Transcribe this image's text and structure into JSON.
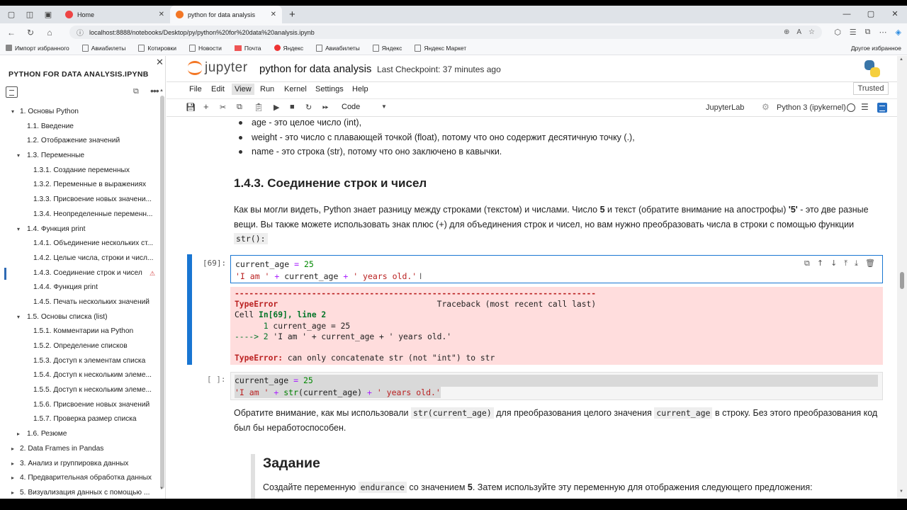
{
  "browser": {
    "tabs": [
      {
        "label": "Home"
      },
      {
        "label": "python for data analysis"
      }
    ],
    "url": "localhost:8888/notebooks/Desktop/py/python%20for%20data%20analysis.ipynb",
    "bookmarks": [
      "Импорт избранного",
      "Авиабилеты",
      "Котировки",
      "Новости",
      "Почта",
      "Яндекс",
      "Авиабилеты",
      "Яндекс",
      "Яндекс Маркет"
    ],
    "bookmarks_right": "Другое избранное"
  },
  "sidebar": {
    "title": "PYTHON FOR DATA ANALYSIS.IPYNB",
    "items": [
      {
        "label": "1. Основы Python",
        "level": 1,
        "caret": "▾"
      },
      {
        "label": "1.1. Введение",
        "level": 2,
        "caret": ""
      },
      {
        "label": "1.2. Отображение значений",
        "level": 2,
        "caret": ""
      },
      {
        "label": "1.3. Переменные",
        "level": 2,
        "caret": "▾"
      },
      {
        "label": "1.3.1. Создание переменных",
        "level": 3,
        "caret": ""
      },
      {
        "label": "1.3.2. Переменные в выражениях",
        "level": 3,
        "caret": ""
      },
      {
        "label": "1.3.3. Присвоение новых значени...",
        "level": 3,
        "caret": ""
      },
      {
        "label": "1.3.4. Неопределенные переменн...",
        "level": 3,
        "caret": ""
      },
      {
        "label": "1.4. Функция print",
        "level": 2,
        "caret": "▾"
      },
      {
        "label": "1.4.1. Объединение нескольких ст...",
        "level": 3,
        "caret": ""
      },
      {
        "label": "1.4.2. Целые числа, строки и числ...",
        "level": 3,
        "caret": ""
      },
      {
        "label": "1.4.3. Соединение строк и чисел",
        "level": 3,
        "caret": "",
        "current": true,
        "warning": "⚠"
      },
      {
        "label": "1.4.4. Функция print",
        "level": 3,
        "caret": ""
      },
      {
        "label": "1.4.5. Печать нескольких значений",
        "level": 3,
        "caret": ""
      },
      {
        "label": "1.5. Основы списка (list)",
        "level": 2,
        "caret": "▾"
      },
      {
        "label": "1.5.1. Комментарии на Python",
        "level": 3,
        "caret": ""
      },
      {
        "label": "1.5.2. Определение списков",
        "level": 3,
        "caret": ""
      },
      {
        "label": "1.5.3. Доступ к элементам списка",
        "level": 3,
        "caret": ""
      },
      {
        "label": "1.5.4. Доступ к нескольким элеме...",
        "level": 3,
        "caret": ""
      },
      {
        "label": "1.5.5. Доступ к нескольким элеме...",
        "level": 3,
        "caret": ""
      },
      {
        "label": "1.5.6. Присвоение новых значений",
        "level": 3,
        "caret": ""
      },
      {
        "label": "1.5.7. Проверка размер списка",
        "level": 3,
        "caret": ""
      },
      {
        "label": "1.6. Резюме",
        "level": 2,
        "caret": "▸"
      },
      {
        "label": "2. Data Frames in Pandas",
        "level": 1,
        "caret": "▸"
      },
      {
        "label": "3. Анализ и группировка данных",
        "level": 1,
        "caret": "▸"
      },
      {
        "label": "4. Предварительная обработка данных",
        "level": 1,
        "caret": "▸"
      },
      {
        "label": "5. Визуализация данных с помощью ...",
        "level": 1,
        "caret": "▸"
      }
    ]
  },
  "header": {
    "logo_text": "jupyter",
    "notebook_name": "python for data analysis",
    "checkpoint": "Last Checkpoint: 37 minutes ago"
  },
  "menu": {
    "items": [
      "File",
      "Edit",
      "View",
      "Run",
      "Kernel",
      "Settings",
      "Help"
    ],
    "trusted": "Trusted"
  },
  "toolbar": {
    "cell_type": "Code",
    "jupyterlab": "JupyterLab",
    "kernel": "Python 3 (ipykernel)"
  },
  "content": {
    "bullets": [
      "age - это целое число (int),",
      "weight - это число с плавающей точкой (float), потому что оно содержит десятичную точку (.),",
      "name - это строка (str), потому что оно заключено в кавычки."
    ],
    "heading": "1.4.3. Соединение строк и чисел",
    "para1_a": "Как вы могли видеть, Python знает разницу между строками (текстом) и числами. Число ",
    "para1_b": "5",
    "para1_c": " и текст (обратите внимание на апострофы) ",
    "para1_d": "'5'",
    "para1_e": " - это две разные вещи. Вы также можете использовать знак плюс (+) для объединения строк и чисел, но вам нужно преобразовать числа в строки с помощью функции",
    "para1_code": "str():",
    "cell1": {
      "prompt": "[69]:",
      "line1_var": "current_age",
      "line1_op": " = ",
      "line1_num": "25",
      "line2_s1": "'I am '",
      "line2_p1": " + ",
      "line2_var": "current_age",
      "line2_p2": " + ",
      "line2_s2": "' years old.'"
    },
    "error": {
      "dashes": "---------------------------------------------------------------------------",
      "type": "TypeError",
      "traceback": "Traceback (most recent call last)",
      "cell_line_a": "Cell ",
      "cell_line_b": "In[69], line 2",
      "line_1_num": "      1",
      "line_1_code": " current_age = 25",
      "arrow": "----> 2",
      "arrow_code": " 'I am ' + current_age + ' years old.'",
      "msg_type": "TypeError:",
      "msg": " can only concatenate str (not \"int\") to str"
    },
    "cell2": {
      "prompt": "[ ]:",
      "line1_var": "current_age",
      "line1_op": " = ",
      "line1_num": "25",
      "line2_s1": "'I am '",
      "line2_p1": " + ",
      "line2_fn": "str",
      "line2_arg": "(current_age)",
      "line2_p2": " + ",
      "line2_s2": "' years old.'"
    },
    "para2_a": "Обратите внимание, как мы использовали ",
    "para2_code1": "str(current_age)",
    "para2_b": " для преобразования целого значения ",
    "para2_code2": "current_age",
    "para2_c": " в строку. Без этого преобразования код был бы неработоспособен.",
    "task_heading": "Задание",
    "para3_a": "Создайте переменную ",
    "para3_code": "endurance",
    "para3_b": " со значением ",
    "para3_bold": "5",
    "para3_c": ". Затем используйте эту переменную для отображения следующего предложения:"
  }
}
